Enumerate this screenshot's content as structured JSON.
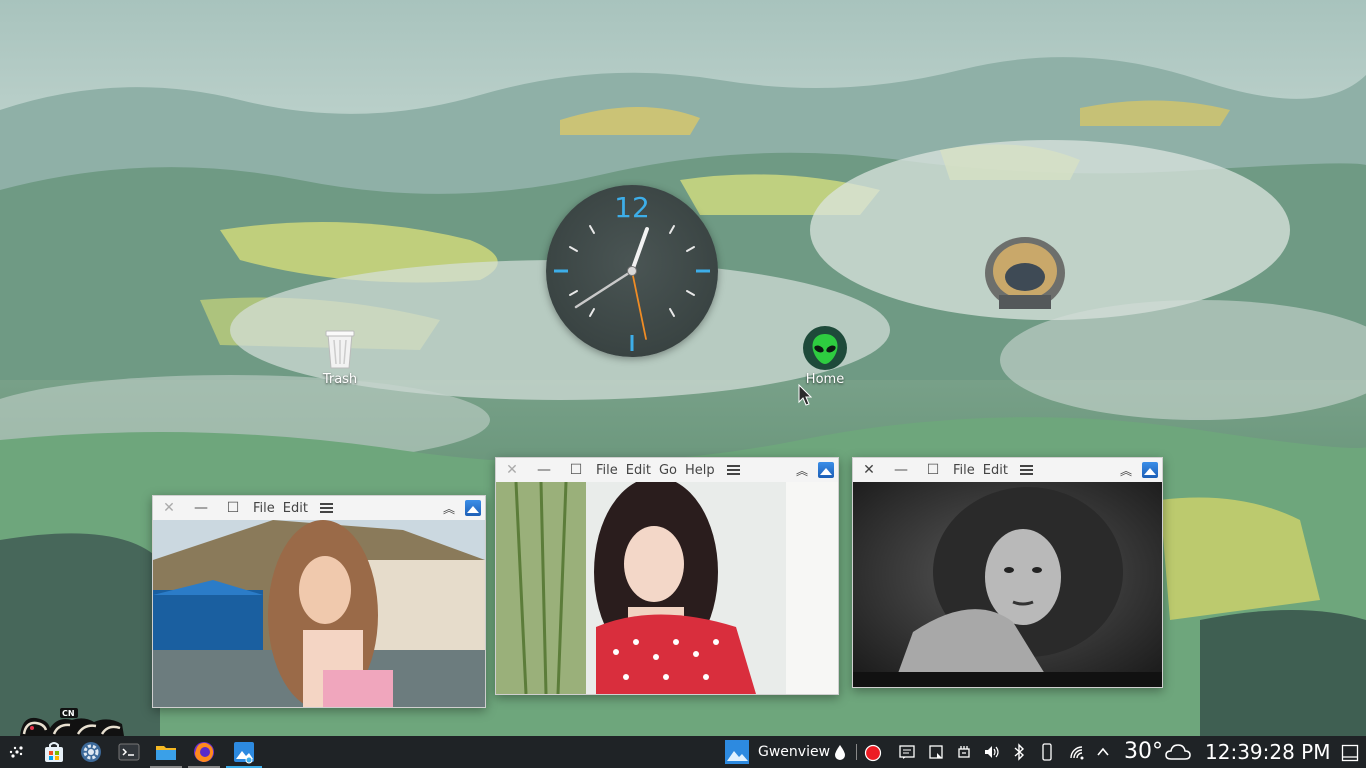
{
  "desktop": {
    "icons": [
      {
        "label": "Trash",
        "icon": "trash-icon"
      },
      {
        "label": "Home",
        "icon": "alien-home-icon"
      }
    ],
    "clock": {
      "twelve_label": "12"
    },
    "brand_logo_text": "CN MAOMAO"
  },
  "windows": [
    {
      "menus": [
        "File",
        "Edit"
      ],
      "image_desc": "photo"
    },
    {
      "menus": [
        "File",
        "Edit",
        "Go",
        "Help"
      ],
      "image_desc": "photo"
    },
    {
      "menus": [
        "File",
        "Edit"
      ],
      "image_desc": "photo"
    }
  ],
  "taskbar": {
    "launchers": [
      "application-launcher-icon",
      "store-icon",
      "settings-icon",
      "terminal-icon",
      "file-manager-icon",
      "firefox-icon",
      "gwenview-icon"
    ],
    "active_task_label": "Gwenview",
    "weather_temp": "30°",
    "time": "12:39:28 PM"
  },
  "colors": {
    "accent": "#3daee9",
    "taskbar_bg": "#1f2326",
    "home_icon_green": "#2ecc40",
    "record_red": "#ed1c24",
    "clock_minute_hand_orange": "#f08c24"
  }
}
